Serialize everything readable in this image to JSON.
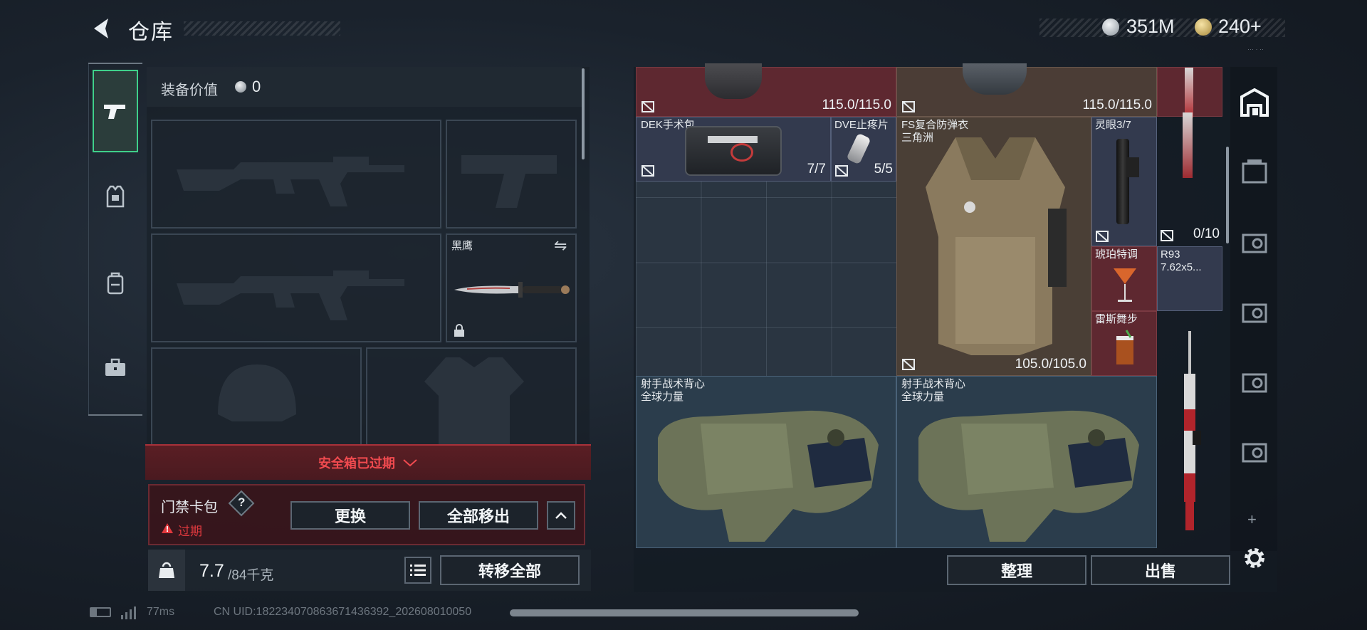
{
  "header": {
    "back_label": "仓库",
    "currency_silver": "351M",
    "currency_gold": "240+",
    "tiny_text": "···  ·  ··"
  },
  "loadout": {
    "equip_value_label": "装备价值",
    "equip_value": "0",
    "knife_name": "黑鹰"
  },
  "safebox": {
    "expired_banner": "安全箱已过期",
    "card_pack_label": "门禁卡包",
    "help": "?",
    "expired_status": "过期",
    "replace_button": "更换",
    "remove_all_button": "全部移出"
  },
  "footer_left": {
    "weight_current": "7.7",
    "weight_max": "/84千克",
    "transfer_all_button": "转移全部"
  },
  "grid_items": {
    "top_left_durability": "115.0/115.0",
    "top_mid_durability": "115.0/115.0",
    "medkit_name": "DEK手术包",
    "medkit_count": "7/7",
    "painkiller_name": "DVE止疼片",
    "painkiller_count": "5/5",
    "armor_name_line1": "FS复合防弹衣",
    "armor_name_line2": "三角洲",
    "armor_durability": "105.0/105.0",
    "scope_name": "灵眼3/7",
    "ammo_count": "0/10",
    "amber_name": "琥珀特调",
    "ammo_name_line1": "R93",
    "ammo_name_line2": "7.62x5...",
    "drink_name": "雷斯舞步",
    "vest1_line1": "射手战术背心",
    "vest1_line2": "全球力量",
    "vest2_line1": "射手战术背心",
    "vest2_line2": "全球力量"
  },
  "footer_right": {
    "sort_button": "整理",
    "sell_button": "出售"
  },
  "status_bar": {
    "ping": "77ms",
    "uid": "CN UID:18223407086367143​6392_202608010050"
  },
  "colors": {
    "accent_green": "#3fd08a",
    "alert_red": "#e0393e",
    "red_row": "#6b2a32",
    "armor_bg": "#4a3f36"
  }
}
